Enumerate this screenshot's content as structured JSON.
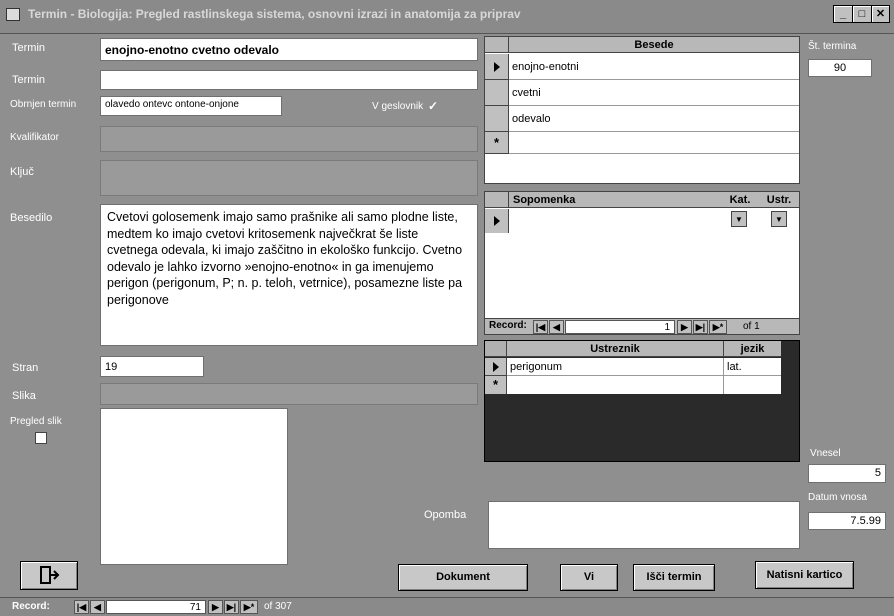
{
  "window": {
    "title": "Termin - Biologija: Pregled rastlinskega sistema, osnovni izrazi in anatomija za priprav",
    "minimize_glyph": "_",
    "restore_glyph": "□",
    "close_glyph": "✕"
  },
  "form": {
    "termin_label": "Termin",
    "termin_value": "enojno-enotno cvetno odevalo",
    "termin2_label": "Termin",
    "termin2_value": "",
    "obrnjen_label": "Obrnjen termin",
    "obrnjen_value": "olavedo ontevc ontone-onjone",
    "v_geslovnik_label": "V geslovnik",
    "v_geslovnik_checked": true,
    "kvalifikator_label": "Kvalifikator",
    "kljuc_label": "Ključ",
    "besedilo_label": "Besedilo",
    "besedilo_text": "Cvetovi golosemenk imajo samo prašnike ali samo plodne liste, medtem ko imajo cvetovi kritosemenk največkrat še liste cvetnega odevala, ki imajo zaščitno in ekološko funkcijo. Cvetno odevalo je lahko izvorno »enojno-enotno« in ga imenujemo perigon (perigonum, P; n. p. teloh, vetrnice), posamezne liste pa perigonove",
    "stran_label": "Stran",
    "stran_value": "19",
    "slika_label": "Slika",
    "pregled_slik_label": "Pregled slik",
    "opomba_label": "Opomba",
    "st_termina_label": "Št. termina",
    "st_termina_value": "90",
    "vnesel_label": "Vnesel",
    "vnesel_value": "5",
    "datum_label": "Datum vnosa",
    "datum_value": "7.5.99"
  },
  "besede": {
    "header": "Besede",
    "rows": [
      "enojno-enotni",
      "cvetni",
      "odevalo"
    ],
    "new_row_glyph": "*"
  },
  "sopomenke": {
    "col_sopomenka": "Sopomenka",
    "col_kat": "Kat.",
    "col_ustr": "Ustr.",
    "nav_label": "Record:",
    "nav_current": "1",
    "nav_of": "of 1"
  },
  "ustreznik": {
    "col_ustreznik": "Ustreznik",
    "col_jezik": "jezik",
    "rows": [
      {
        "ustreznik": "perigonum",
        "jezik": "lat."
      }
    ],
    "new_row_glyph": "*"
  },
  "buttons": {
    "dokument": "Dokument",
    "vi": "Vi",
    "isci": "Išči termin",
    "natisni": "Natisni kartico"
  },
  "navigator": {
    "label": "Record:",
    "current": "71",
    "of": "of 307"
  }
}
